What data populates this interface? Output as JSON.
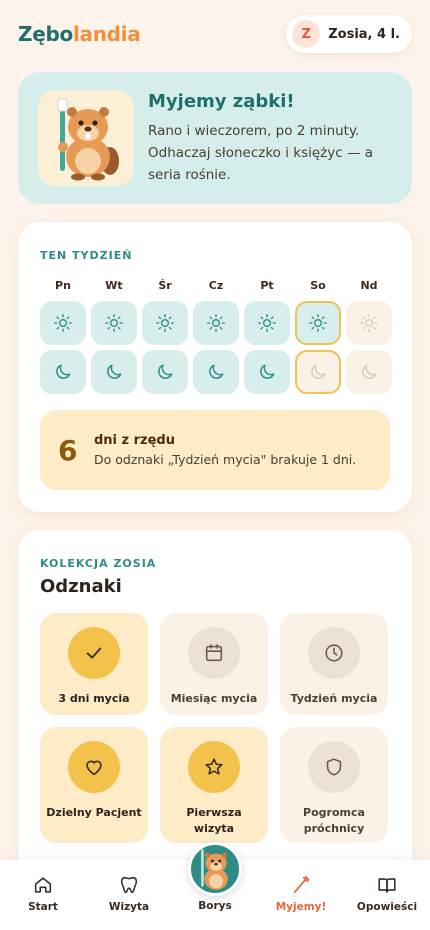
{
  "app": {
    "logo_part1": "Zębo",
    "logo_part2": "landia",
    "profile_initial": "Z",
    "profile_name": "Zosia, 4 l."
  },
  "hero": {
    "title": "Myjemy ząbki!",
    "description": "Rano i wieczorem, po 2 minuty. Odhaczaj słoneczko i księżyc — a seria rośnie.",
    "image_icon": "beaver-with-toothbrush-icon"
  },
  "week": {
    "label": "TEN TYDZIEŃ",
    "days": [
      "Pn",
      "Wt",
      "Śr",
      "Cz",
      "Pt",
      "So",
      "Nd"
    ],
    "morning": [
      "done",
      "done",
      "done",
      "done",
      "done",
      "today-done",
      "empty"
    ],
    "evening": [
      "done",
      "done",
      "done",
      "done",
      "done",
      "today-empty",
      "empty"
    ],
    "streak_number": "6",
    "streak_title": "dni z rzędu",
    "streak_desc": "Do odznaki „Tydzień mycia\" brakuje 1 dni."
  },
  "badges": {
    "label": "KOLEKCJA ZOSIA",
    "title": "Odznaki",
    "items": [
      {
        "label": "3 dni mycia",
        "earned": true,
        "icon": "check-icon"
      },
      {
        "label": "Miesiąc mycia",
        "earned": false,
        "icon": "calendar-icon"
      },
      {
        "label": "Tydzień mycia",
        "earned": false,
        "icon": "clock-icon"
      },
      {
        "label": "Dzielny Pacjent",
        "earned": true,
        "icon": "heart-icon"
      },
      {
        "label": "Pierwsza wizyta",
        "earned": true,
        "icon": "star-icon"
      },
      {
        "label": "Pogromca próchnicy",
        "earned": false,
        "icon": "shield-icon"
      }
    ]
  },
  "nav": {
    "items": [
      {
        "label": "Start",
        "icon": "home-icon"
      },
      {
        "label": "Wizyta",
        "icon": "tooth-icon"
      },
      {
        "label": "Borys",
        "icon": "beaver-icon"
      },
      {
        "label": "Myjemy!",
        "icon": "toothbrush-icon"
      },
      {
        "label": "Opowieści",
        "icon": "book-icon"
      }
    ],
    "active_index": 3
  },
  "colors": {
    "teal": "#2e8c85",
    "orange": "#f0903a",
    "gold": "#f2c24a",
    "background": "#fdf3ea"
  }
}
